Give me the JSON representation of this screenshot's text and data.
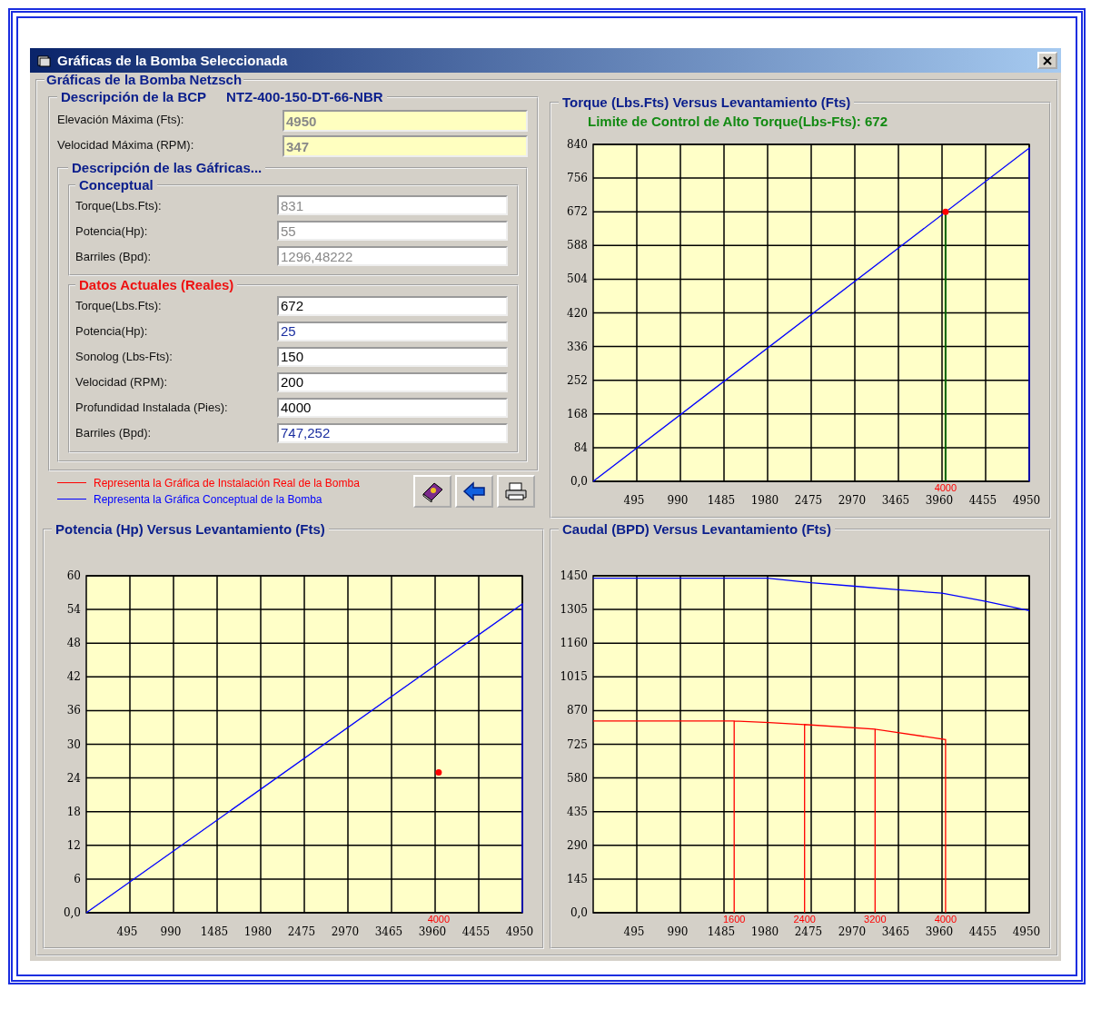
{
  "window": {
    "title": "Gráficas de la Bomba Seleccionada"
  },
  "group_title": "Gráficas de la Bomba Netzsch",
  "pump": {
    "title": "Descripción de la BCP",
    "model": "NTZ-400-150-DT-66-NBR",
    "fields": [
      {
        "label": "Elevación Máxima (Fts):",
        "value": "4950",
        "kind": "limit"
      },
      {
        "label": "Velocidad Máxima (RPM):",
        "value": "347",
        "kind": "limit"
      }
    ],
    "charts_description": {
      "title": "Descripción de las Gáfricas...",
      "groups": [
        {
          "title": "Conceptual",
          "kind": "conceptual",
          "fields": [
            {
              "label": "Torque(Lbs.Fts):",
              "value": "831",
              "kind": "conceptual"
            },
            {
              "label": "Potencia(Hp):",
              "value": "55",
              "kind": "conceptual"
            },
            {
              "label": "Barriles (Bpd):",
              "value": "1296,48222",
              "kind": "conceptual"
            }
          ]
        },
        {
          "title": "Datos Actuales (Reales)",
          "kind": "real",
          "fields": [
            {
              "label": "Torque(Lbs.Fts):",
              "value": "672",
              "kind": "entry"
            },
            {
              "label": "Potencia(Hp):",
              "value": "25",
              "kind": "calculated"
            },
            {
              "label": "Sonolog (Lbs-Fts):",
              "value": "150",
              "kind": "entry"
            },
            {
              "label": "Velocidad (RPM):",
              "value": "200",
              "kind": "entry"
            },
            {
              "label": "Profundidad Instalada (Pies):",
              "value": "4000",
              "kind": "entry"
            },
            {
              "label": "Barriles (Bpd):",
              "value": "747,252",
              "kind": "calculated"
            }
          ]
        }
      ]
    }
  },
  "legend": [
    {
      "label": "Representa la Gráfica de Instalación Real de la Bomba",
      "color": "#ff0000"
    },
    {
      "label": "Representa la Gráfica Conceptual de la Bomba",
      "color": "#0000ff"
    }
  ],
  "toolbar": [
    {
      "kind": "book"
    },
    {
      "kind": "back"
    },
    {
      "kind": "print"
    }
  ],
  "torque_panel": {
    "title": "Torque (Lbs.Fts) Versus Levantamiento (Fts)",
    "limit_text": "Limite de Control de Alto Torque(Lbs-Fts):  672",
    "chart_data": {
      "type": "line",
      "grid": true,
      "xlim": [
        0,
        4950
      ],
      "ylim": [
        0,
        840
      ],
      "xticks": [
        495,
        990,
        1485,
        1980,
        2475,
        2970,
        3465,
        3960,
        4455,
        4950
      ],
      "yticks": [
        {
          "value": 0,
          "label": "0,0"
        },
        84,
        168,
        252,
        336,
        420,
        504,
        588,
        672,
        756,
        840
      ],
      "series": [
        {
          "color": "#0000ff",
          "x": [
            0,
            4950,
            4950
          ],
          "values": [
            0,
            831,
            0
          ]
        },
        {
          "color": "#006400",
          "x": [
            4000,
            4000
          ],
          "values": [
            672,
            0
          ]
        },
        {
          "color": "#ff0000",
          "x": [
            4000
          ],
          "values": [
            672
          ],
          "marker": "circle"
        }
      ],
      "annotations": [
        {
          "x": 4000,
          "y": 0,
          "text": "4000"
        }
      ]
    }
  },
  "power_panel": {
    "title": "Potencia (Hp) Versus Levantamiento (Fts)",
    "chart_data": {
      "type": "line",
      "grid": true,
      "xlim": [
        0,
        4950
      ],
      "ylim": [
        0,
        60
      ],
      "xticks": [
        495,
        990,
        1485,
        1980,
        2475,
        2970,
        3465,
        3960,
        4455,
        4950
      ],
      "yticks": [
        {
          "value": 0,
          "label": "0,0"
        },
        6,
        12,
        18,
        24,
        30,
        36,
        42,
        48,
        54,
        60
      ],
      "series": [
        {
          "color": "#0000ff",
          "x": [
            0,
            4950,
            4950
          ],
          "values": [
            0,
            55,
            0
          ]
        },
        {
          "color": "#ff0000",
          "x": [
            4000
          ],
          "values": [
            25
          ],
          "marker": "circle"
        }
      ],
      "annotations": [
        "4000"
      ]
    }
  },
  "flow_panel": {
    "title": "Caudal (BPD) Versus Levantamiento (Fts)",
    "chart_data": {
      "type": "line",
      "grid": true,
      "xlim": [
        0,
        4950
      ],
      "ylim": [
        0,
        1450
      ],
      "xticks": [
        495,
        990,
        1485,
        1980,
        2475,
        2970,
        3465,
        3960,
        4455,
        4950
      ],
      "yticks": [
        {
          "value": 0,
          "label": "0,0"
        },
        145,
        290,
        435,
        580,
        725,
        870,
        1015,
        1160,
        1305,
        1450
      ],
      "series": [
        {
          "color": "#0000ff",
          "x": [
            0,
            1980,
            2475,
            2970,
            3465,
            3960,
            4455,
            4950
          ],
          "values": [
            1440,
            1440,
            1420,
            1405,
            1390,
            1375,
            1340,
            1300
          ]
        },
        {
          "color": "#ff0000",
          "x": [
            0,
            1600,
            1600,
            1600,
            2000,
            2400,
            2400,
            2400,
            3200,
            3200,
            3200,
            4000,
            4000
          ],
          "values": [
            825,
            825,
            0,
            825,
            818,
            810,
            0,
            810,
            790,
            0,
            790,
            745,
            0
          ]
        }
      ],
      "annotations": [
        {
          "x": 1600,
          "y": 0,
          "text": "1600"
        },
        {
          "x": 2400,
          "y": 0,
          "text": "2400"
        },
        {
          "x": 3200,
          "y": 0,
          "text": "3200"
        },
        {
          "x": 4000,
          "y": 0,
          "text": "4000"
        }
      ]
    }
  }
}
